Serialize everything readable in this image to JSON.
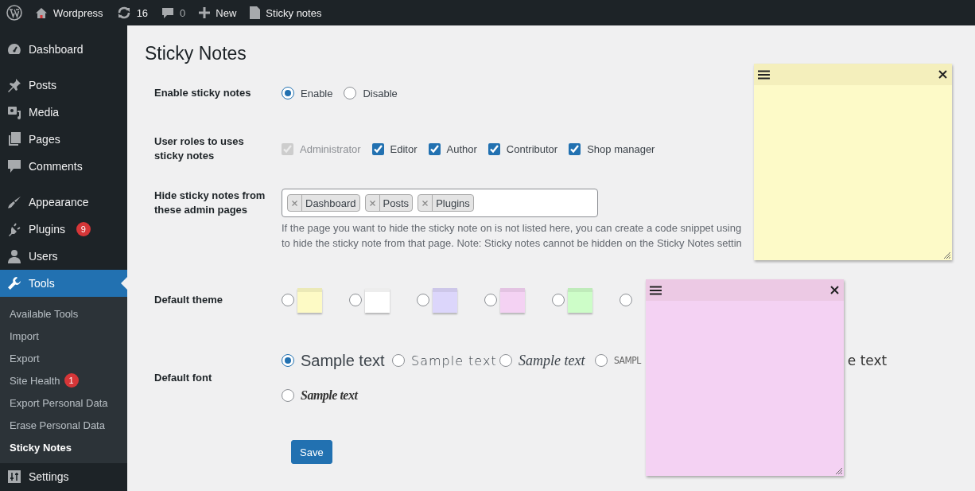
{
  "admin_bar": {
    "site": "Wordpress",
    "updates": "16",
    "comments": "0",
    "new": "New",
    "page": "Sticky notes"
  },
  "sidebar": {
    "groups": [
      [
        {
          "label": "Dashboard",
          "selected": false
        }
      ],
      [
        {
          "label": "Posts",
          "selected": false
        },
        {
          "label": "Media",
          "selected": false
        },
        {
          "label": "Pages",
          "selected": false
        },
        {
          "label": "Comments",
          "selected": false
        }
      ],
      [
        {
          "label": "Appearance",
          "selected": false
        },
        {
          "label": "Plugins",
          "badge": "9",
          "selected": false
        },
        {
          "label": "Users",
          "selected": false
        },
        {
          "label": "Tools",
          "selected": true,
          "children": [
            {
              "label": "Available Tools",
              "selected": false
            },
            {
              "label": "Import",
              "selected": false
            },
            {
              "label": "Export",
              "selected": false
            },
            {
              "label": "Site Health",
              "badge": "1",
              "selected": false
            },
            {
              "label": "Export Personal Data",
              "selected": false
            },
            {
              "label": "Erase Personal Data",
              "selected": false
            },
            {
              "label": "Sticky Notes",
              "selected": true
            }
          ]
        },
        {
          "label": "Settings",
          "selected": false
        }
      ]
    ]
  },
  "page_title": "Sticky Notes",
  "settings": [
    {
      "kind": "radio",
      "label": "Enable sticky notes",
      "options": [
        {
          "label": "Enable",
          "selected": true
        },
        {
          "label": "Disable",
          "selected": false
        }
      ]
    },
    {
      "kind": "checkboxes",
      "label": "User roles to uses sticky notes",
      "options": [
        {
          "label": "Administrator",
          "checked": true,
          "disabled": true
        },
        {
          "label": "Editor",
          "checked": true,
          "disabled": false
        },
        {
          "label": "Author",
          "checked": true,
          "disabled": false
        },
        {
          "label": "Contributor",
          "checked": true,
          "disabled": false
        },
        {
          "label": "Shop manager",
          "checked": true,
          "disabled": false
        }
      ]
    },
    {
      "kind": "tags",
      "label": "Hide sticky notes from these admin pages",
      "tags": [
        "Dashboard",
        "Posts",
        "Plugins"
      ],
      "help": [
        "If the page you want to hide the sticky note on is not listed here, you can create a code snippet using",
        "to hide the sticky note from that page. Note: Sticky notes cannot be hidden on the Sticky Notes settin"
      ]
    },
    {
      "kind": "themes",
      "label": "Default theme",
      "options": [
        {
          "color": "#fdfac5",
          "selected": false
        },
        {
          "color": "#ffffff",
          "selected": false
        },
        {
          "color": "#dcd6fb",
          "selected": false
        },
        {
          "color": "#f4d2f3",
          "selected": false
        },
        {
          "color": "#cdfdc8",
          "selected": false
        },
        {
          "selected": false
        }
      ]
    },
    {
      "kind": "fonts",
      "label": "Default font",
      "options": [
        {
          "label": "Sample text",
          "selected": true
        },
        {
          "label": "Sample text",
          "selected": false
        },
        {
          "label": "Sample text",
          "selected": false
        },
        {
          "label": "SAMPL",
          "selected": false
        },
        {
          "label": "e text"
        },
        {
          "label": "Sample text",
          "selected": false
        }
      ]
    }
  ],
  "save_button": "Save",
  "notes": [
    {
      "color": "#fdfac8"
    },
    {
      "color": "#f4d2f3"
    }
  ]
}
